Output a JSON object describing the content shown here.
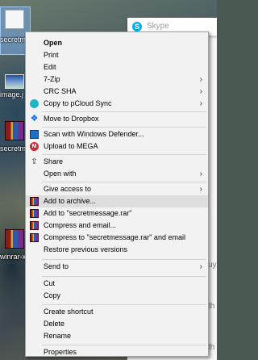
{
  "desktop": {
    "icons": [
      {
        "name": "secretmessage-file-icon",
        "label": "secretme e.txt"
      },
      {
        "name": "image-file-icon",
        "label": "image.j"
      },
      {
        "name": "secretmessage-rar-icon",
        "label": "secretm"
      },
      {
        "name": "winrar-icon",
        "label": "winrar-x"
      }
    ],
    "background_fragments": [
      "uy",
      "th",
      "th"
    ]
  },
  "skype": {
    "title": "Skype",
    "icon": "S"
  },
  "context_menu": {
    "items": [
      {
        "label": "Open",
        "bold": true
      },
      {
        "label": "Print"
      },
      {
        "label": "Edit"
      },
      {
        "label": "7-Zip",
        "submenu": true
      },
      {
        "label": "CRC SHA",
        "submenu": true
      },
      {
        "label": "Copy to pCloud Sync",
        "submenu": true,
        "icon": "pcloud-icon"
      },
      {
        "label": "Move to Dropbox",
        "icon": "dropbox-icon"
      },
      {
        "label": "Scan with Windows Defender...",
        "icon": "windows-defender-icon"
      },
      {
        "label": "Upload to MEGA",
        "icon": "mega-icon"
      },
      {
        "label": "Share",
        "icon": "share-icon"
      },
      {
        "label": "Open with",
        "submenu": true
      },
      {
        "label": "Give access to",
        "submenu": true
      },
      {
        "label": "Add to archive...",
        "icon": "winrar-icon",
        "highlighted": true
      },
      {
        "label": "Add to \"secretmessage.rar\"",
        "icon": "winrar-icon"
      },
      {
        "label": "Compress and email...",
        "icon": "winrar-icon"
      },
      {
        "label": "Compress to \"secretmessage.rar\" and email",
        "icon": "winrar-icon"
      },
      {
        "label": "Restore previous versions"
      },
      {
        "label": "Send to",
        "submenu": true
      },
      {
        "label": "Cut"
      },
      {
        "label": "Copy"
      },
      {
        "label": "Create shortcut"
      },
      {
        "label": "Delete"
      },
      {
        "label": "Rename"
      },
      {
        "label": "Properties"
      }
    ],
    "submenu_arrow": "›",
    "colors": {
      "background": "#f2f2f2",
      "highlight": "#dedede",
      "separator": "#d4d4d4"
    }
  }
}
